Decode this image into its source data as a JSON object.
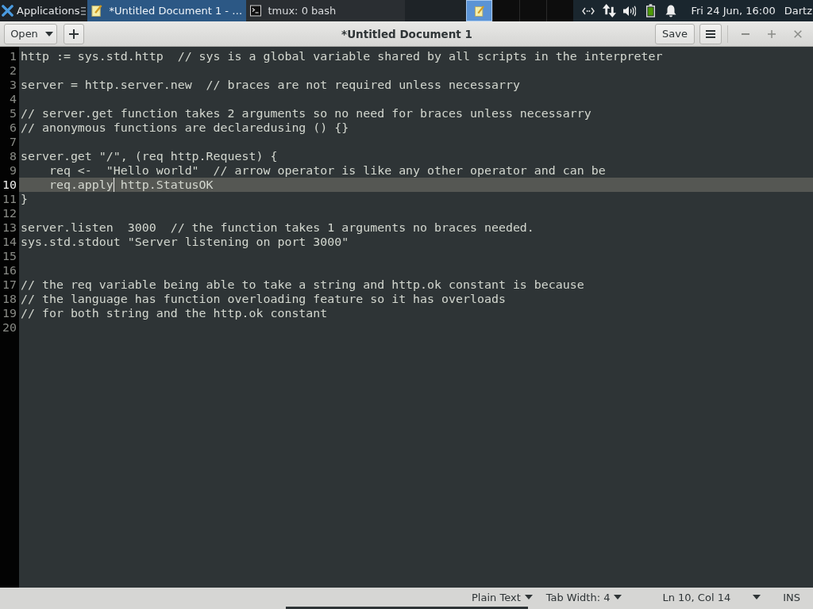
{
  "top_panel": {
    "applications_menu": {
      "label": "Applications"
    },
    "tasks": [
      {
        "kind": "editor",
        "label": "*Untitled Document 1 - …",
        "selected": true
      },
      {
        "kind": "terminal",
        "label": "tmux: 0 bash",
        "selected": false
      }
    ],
    "workspaces": [
      {
        "kind": "editor",
        "selected": true
      },
      {
        "kind": "empty",
        "selected": false
      },
      {
        "kind": "empty",
        "selected": false
      },
      {
        "kind": "empty",
        "selected": false
      }
    ],
    "clock": "Fri 24 Jun, 16:00",
    "user": "Dartz"
  },
  "header_bar": {
    "open_button": "Open",
    "title": "*Untitled Document 1",
    "save_button": "Save"
  },
  "editor": {
    "lines": [
      {
        "number": "1",
        "text": "http := sys.std.http  // sys is a global variable shared by all scripts in the interpreter",
        "current": false
      },
      {
        "number": "2",
        "current": false
      },
      {
        "number": "3",
        "text": "server = http.server.new  // braces are not required unless necessarry",
        "current": false
      },
      {
        "number": "4",
        "current": false
      },
      {
        "number": "5",
        "text": "// server.get function takes 2 arguments so no need for braces unless necessarry",
        "current": false
      },
      {
        "number": "6",
        "text": "// anonymous functions are declaredusing () {}",
        "current": false
      },
      {
        "number": "7",
        "current": false
      },
      {
        "number": "8",
        "text": "server.get \"/\", (req http.Request) {",
        "current": false
      },
      {
        "number": "9",
        "text": "    req <-  \"Hello world\"  // arrow operator is like any other operator and can be",
        "current": false
      },
      {
        "number": "10",
        "text": "    req.apply",
        "text_after_cursor": " http.StatusOK",
        "current": true,
        "cursor": true
      },
      {
        "number": "11",
        "text": "}",
        "current": false
      },
      {
        "number": "12",
        "current": false
      },
      {
        "number": "13",
        "text": "server.listen  3000  // the function takes 1 arguments no braces needed.",
        "current": false
      },
      {
        "number": "14",
        "text": "sys.std.stdout \"Server listening on port 3000\"",
        "current": false
      },
      {
        "number": "15",
        "current": false
      },
      {
        "number": "16",
        "current": false
      },
      {
        "number": "17",
        "text": "// the req variable being able to take a string and http.ok constant is because",
        "current": false
      },
      {
        "number": "18",
        "text": "// the language has function overloading feature so it has overloads",
        "current": false
      },
      {
        "number": "19",
        "text": "// for both string and the http.ok constant",
        "current": false
      },
      {
        "number": "20",
        "current": false
      }
    ]
  },
  "status_bar": {
    "language": "Plain Text",
    "tab_width": "Tab Width: 4",
    "position": "Ln 10, Col 14",
    "mode": "INS"
  }
}
